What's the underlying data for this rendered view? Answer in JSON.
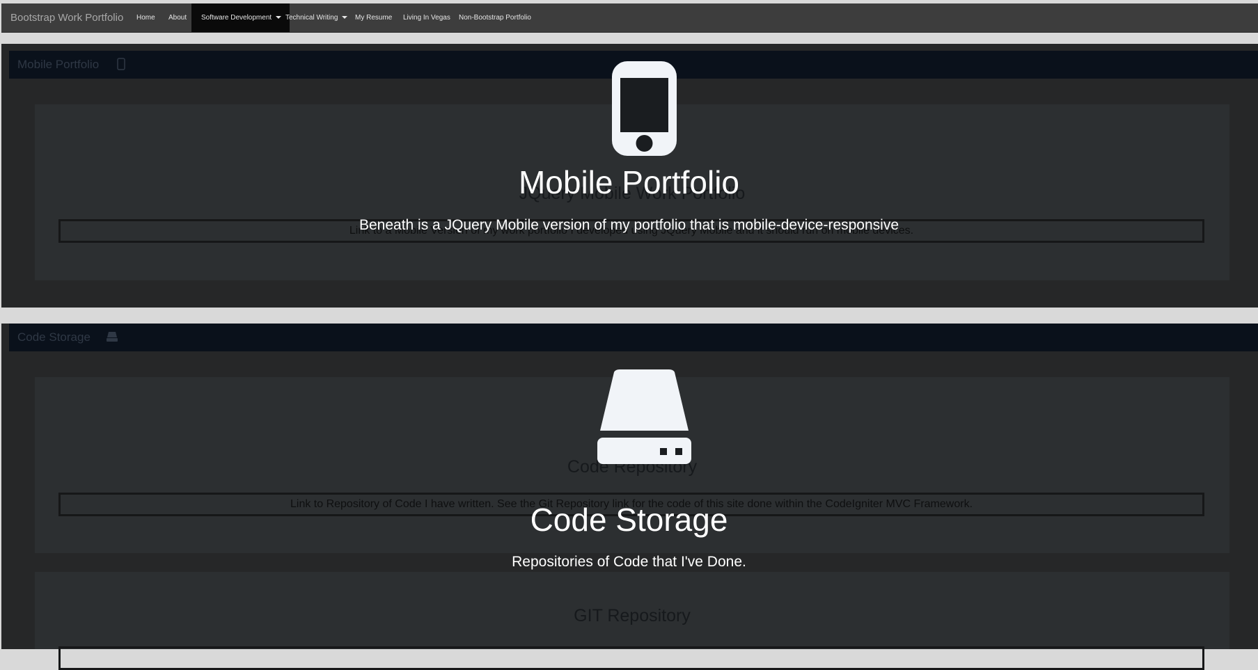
{
  "navbar": {
    "brand": "Bootstrap Work Portfolio",
    "items": [
      {
        "label": "Home"
      },
      {
        "label": "About"
      },
      {
        "label": "Software Development"
      },
      {
        "label": "Technical Writing"
      },
      {
        "label": "My Resume"
      },
      {
        "label": "Living In Vegas"
      },
      {
        "label": "Non-Bootstrap Portfolio"
      }
    ],
    "active_item": "Software Development"
  },
  "mobile_section": {
    "header_title": "Mobile Portfolio",
    "header_icon": "mobile-phone-icon",
    "card_title": "JQuery Mobile Work Portfolio",
    "card_link": "Link to a Mobile Version of my work portfolio I developed using JQuery Mobile and it should run on mobile devices.",
    "overlay_icon": "mobile-phone-icon",
    "overlay_title": "Mobile Portfolio",
    "overlay_subtitle": "Beneath is a JQuery Mobile version of my portfolio that is mobile-device-responsive"
  },
  "code_section": {
    "header_title": "Code Storage",
    "header_icon": "hard-drive-icon",
    "card_title": "Code Repository",
    "card_link": "Link to Repository of Code I have written. See the Git Repository link for the code of this site done within the CodeIgniter MVC Framework.",
    "card2_title": "GIT Repository",
    "overlay_icon": "hard-drive-icon",
    "overlay_title": "Code Storage",
    "overlay_subtitle": "Repositories of Code that I've Done."
  },
  "colors": {
    "navbar_bg": "#3d3d3d",
    "active_nav_bg": "#0a0a0a",
    "section_bg": "#262728",
    "header_bg": "#0a111b",
    "overlay_text": "#ffffff"
  }
}
